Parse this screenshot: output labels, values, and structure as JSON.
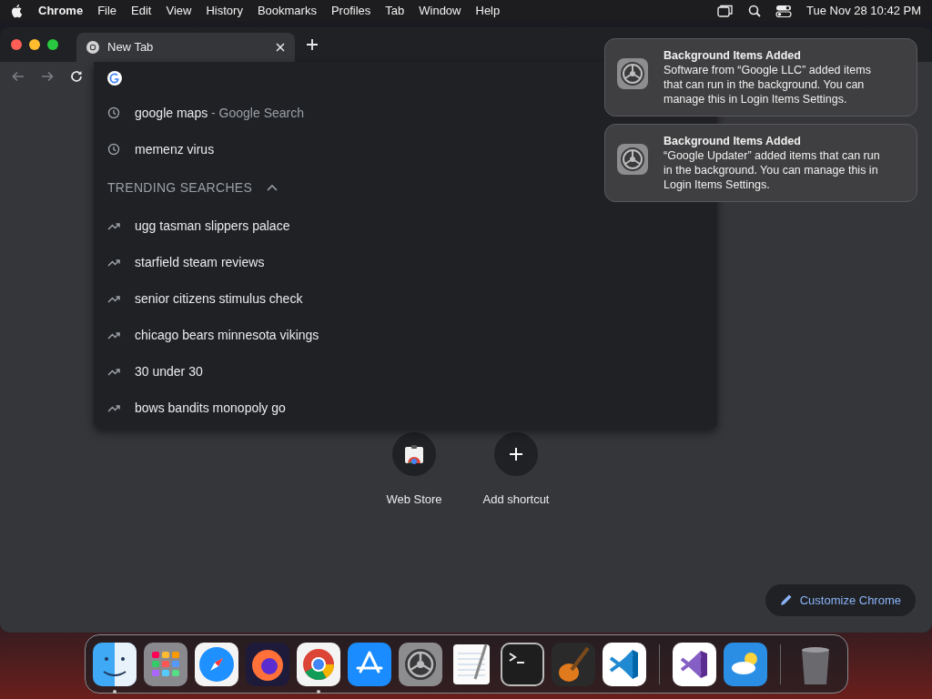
{
  "menubar": {
    "app": "Chrome",
    "menus": [
      "File",
      "Edit",
      "View",
      "History",
      "Bookmarks",
      "Profiles",
      "Tab",
      "Window",
      "Help"
    ],
    "clock": "Tue Nov 28  10:42 PM"
  },
  "tabs": [
    {
      "title": "New Tab",
      "selected": true
    }
  ],
  "omnibox": {
    "history": [
      {
        "text": "google maps",
        "suffix": "- Google Search"
      },
      {
        "text": "memenz virus"
      }
    ],
    "trending": {
      "header": "TRENDING SEARCHES",
      "expanded": true,
      "items": [
        "ugg tasman slippers palace",
        "starfield steam reviews",
        "senior citizens stimulus check",
        "chicago bears minnesota vikings",
        "30 under 30",
        "bows bandits monopoly go"
      ]
    }
  },
  "shortcuts": [
    {
      "kind": "store",
      "label": "Web Store"
    },
    {
      "kind": "add",
      "label": "Add shortcut"
    }
  ],
  "customize_button": "Customize Chrome",
  "notifications": [
    {
      "title": "Background Items Added",
      "body": "Software from “Google LLC” added items that can run in the background. You can manage this in Login Items Settings."
    },
    {
      "title": "Background Items Added",
      "body": "“Google Updater” added items that can run in the background. You can manage this in Login Items Settings."
    }
  ],
  "dock": {
    "groups": [
      [
        {
          "kind": "finder",
          "running": true
        },
        {
          "kind": "launchpad",
          "running": false
        },
        {
          "kind": "safari",
          "running": false
        },
        {
          "kind": "firefox",
          "running": false
        },
        {
          "kind": "chrome",
          "running": true
        },
        {
          "kind": "appstore",
          "running": false
        },
        {
          "kind": "settings",
          "running": false
        },
        {
          "kind": "textedit",
          "running": false
        },
        {
          "kind": "terminal",
          "running": false
        },
        {
          "kind": "guitar",
          "running": false
        },
        {
          "kind": "vscode",
          "running": false
        }
      ],
      [
        {
          "kind": "visualstudio",
          "running": false
        },
        {
          "kind": "weather",
          "running": false
        }
      ],
      [
        {
          "kind": "trash",
          "running": false
        }
      ]
    ]
  }
}
